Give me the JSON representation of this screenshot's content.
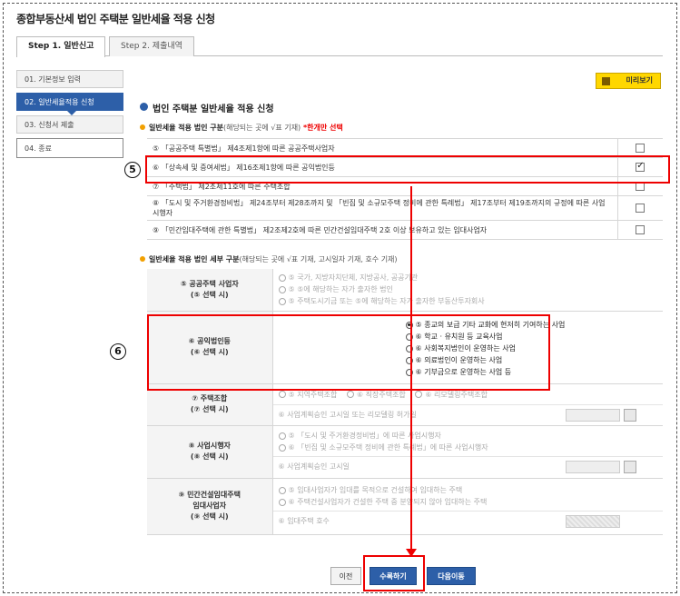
{
  "title": "종합부동산세 법인 주택분 일반세율 적용 신청",
  "tabs": [
    {
      "label": "Step 1. 일반신고"
    },
    {
      "label": "Step 2. 제출내역"
    }
  ],
  "sidebar": [
    {
      "label": "01. 기본정보 입력"
    },
    {
      "label": "02. 일반세율적용 신청"
    },
    {
      "label": "03. 신청서 제출"
    },
    {
      "label": "04. 종료"
    }
  ],
  "preview_label": "미리보기",
  "section_title": "법인 주택분 일반세율 적용 신청",
  "section1": {
    "title": "일반세율 적용 법인 구분",
    "note": "(해당되는 곳에 √표 기재)",
    "red_note": "*한개만 선택",
    "rows": [
      {
        "text": "⑤ 「공공주택 특별법」 제4조제1항에 따른 공공주택사업자",
        "checked": false
      },
      {
        "text": "⑥ 「상속세 및 증여세법」 제16조제1항에 따른 공익법인등",
        "checked": true
      },
      {
        "text": "⑦ 「주택법」 제2조제11호에 따른 주택조합",
        "checked": false
      },
      {
        "text": "⑧ 「도시 및 주거환경정비법」 제24조부터 제28조까지 및 「빈집 및 소규모주택 정비에 관한 특례법」 제17조부터 제19조까지의 규정에 따른 사업시행자",
        "checked": false
      },
      {
        "text": "⑨ 「민간임대주택에 관한 특별법」 제2조제2호에 따른 민간건설임대주택 2호 이상 보유하고 있는 임대사업자",
        "checked": false
      }
    ]
  },
  "section2": {
    "title": "일반세율 적용 법인 세부 구분",
    "note": "(해당되는 곳에 √표 기재, 고시일자 기재, 호수 기재)",
    "groups": [
      {
        "label1": "⑤ 공공주택 사업자",
        "label2": "(⑤ 선택 시)",
        "options": [
          "⑤ 국가, 지방자치단체, 지방공사, 공공기관",
          "⑤ ⑤에 해당하는 자가 출자한 법인",
          "⑤ 주택도시기금 또는 ⑤에 해당하는 자가 출자한 부동산투자회사"
        ]
      },
      {
        "label1": "⑥ 공익법인등",
        "label2": "(⑥ 선택 시)",
        "options": [
          "⑤ 종교의 보급 기타 교화에 현저히 기여하는 사업",
          "⑥ 학교 · 유치원 등 교육사업",
          "⑥ 사회복지법인이 운영하는 사업",
          "⑥ 의료법인이 운영하는 사업",
          "⑥ 기부금으로 운영하는 사업 등"
        ]
      },
      {
        "label1": "⑦ 주택조합",
        "label2": "(⑦ 선택 시)",
        "options": [
          "⑤ 지역주택조합",
          "⑥ 직장주택조합",
          "⑥ 리모델링주택조합"
        ],
        "sub": "⑥ 사업계획승인 고시일 또는 리모델링 허가일"
      },
      {
        "label1": "⑧ 사업시행자",
        "label2": "(⑧ 선택 시)",
        "options": [
          "⑤ 「도시 및 주거환경정비법」에 따른 사업시행자",
          "⑥ 「빈집 및 소규모주택 정비에 관한 특례법」에 따른 사업시행자"
        ],
        "sub": "⑥ 사업계획승인 고시일"
      },
      {
        "label1": "⑨ 민간건설임대주택",
        "label2": "임대사업자",
        "label3": "(⑨ 선택 시)",
        "options": [
          "⑤ 임대사업자가 임대를 목적으로 건설하여 임대하는 주택",
          "⑥ 주택건설사업자가 건설한 주택 중 분양되지 않아 임대하는 주택"
        ],
        "sub": "⑥ 임대주택 호수"
      }
    ]
  },
  "markers": {
    "five": "5",
    "six": "6"
  },
  "buttons": {
    "prev": "이전",
    "submit": "수록하기",
    "next": "다음이동"
  }
}
